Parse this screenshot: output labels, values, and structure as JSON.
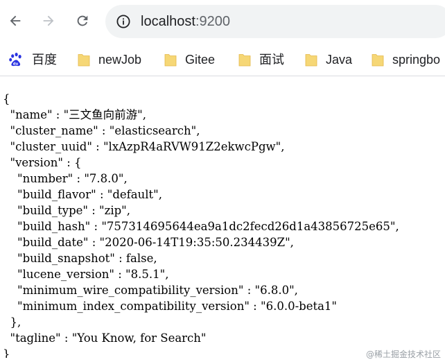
{
  "browser": {
    "url_host": "localhost",
    "url_port": ":9200"
  },
  "bookmarks": [
    {
      "label": "百度",
      "icon": "baidu-icon"
    },
    {
      "label": "newJob",
      "icon": "folder-icon"
    },
    {
      "label": "Gitee",
      "icon": "folder-icon"
    },
    {
      "label": "面试",
      "icon": "folder-icon"
    },
    {
      "label": "Java",
      "icon": "folder-icon"
    },
    {
      "label": "springbo",
      "icon": "folder-icon"
    }
  ],
  "json_lines": [
    "{",
    "  \"name\" : \"三文鱼向前游\",",
    "  \"cluster_name\" : \"elasticsearch\",",
    "  \"cluster_uuid\" : \"lxAzpR4aRVW91Z2ekwcPgw\",",
    "  \"version\" : {",
    "    \"number\" : \"7.8.0\",",
    "    \"build_flavor\" : \"default\",",
    "    \"build_type\" : \"zip\",",
    "    \"build_hash\" : \"757314695644ea9a1dc2fecd26d1a43856725e65\",",
    "    \"build_date\" : \"2020-06-14T19:35:50.234439Z\",",
    "    \"build_snapshot\" : false,",
    "    \"lucene_version\" : \"8.5.1\",",
    "    \"minimum_wire_compatibility_version\" : \"6.8.0\",",
    "    \"minimum_index_compatibility_version\" : \"6.0.0-beta1\"",
    "  },",
    "  \"tagline\" : \"You Know, for Search\"",
    "}"
  ],
  "watermark": "@稀土掘金技术社区",
  "colors": {
    "omnibox_bg": "#f1f3f4",
    "folder_yellow": "#f6d776",
    "baidu_blue": "#2932e1"
  }
}
